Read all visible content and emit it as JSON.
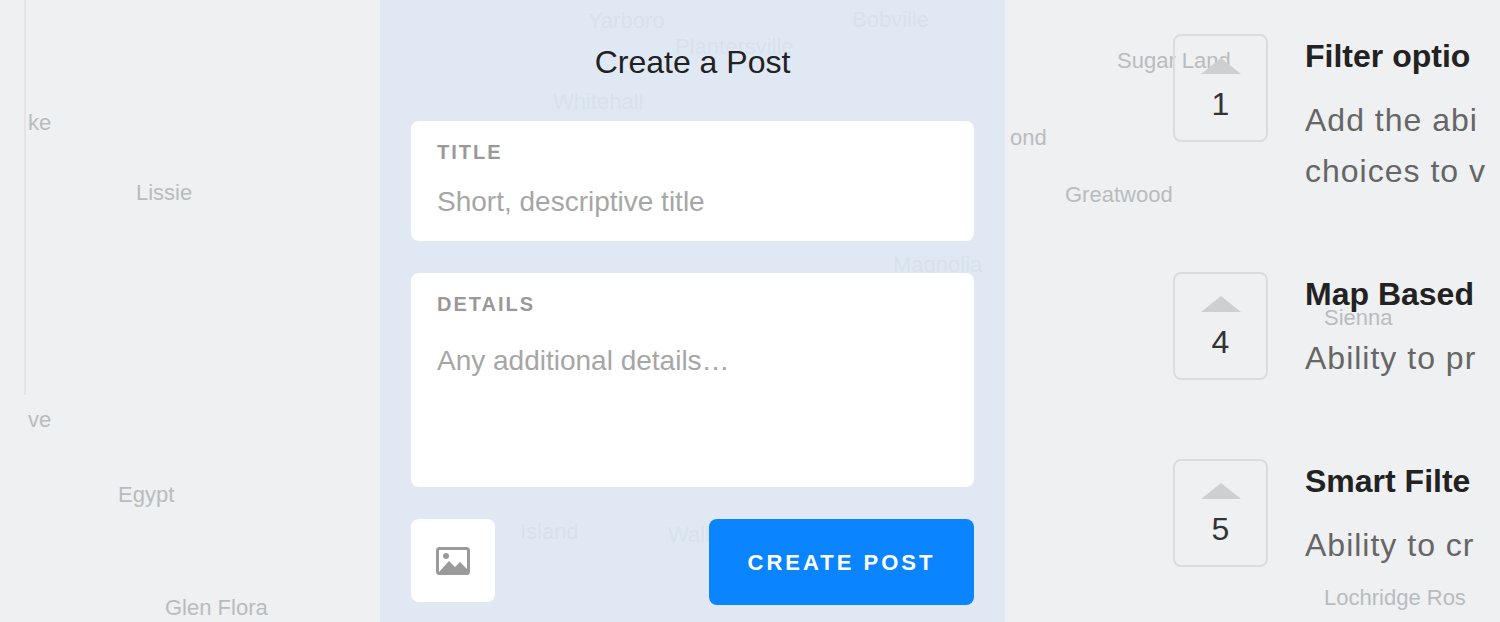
{
  "map": {
    "labels": [
      "ke",
      "Lissie",
      "ve",
      "Egypt",
      "Glen Flora",
      "Yarboro",
      "Plantersville",
      "Bobville",
      "Whitehall",
      "Magnolia",
      "Island",
      "Waller",
      "Sugar Land",
      "ond",
      "Greatwood",
      "Sienna",
      "Lochridge Ros"
    ]
  },
  "form": {
    "title": "Create a Post",
    "fields": [
      {
        "label": "TITLE",
        "placeholder": "Short, descriptive title",
        "kind": "input"
      },
      {
        "label": "DETAILS",
        "placeholder": "Any additional details…",
        "kind": "textarea"
      }
    ],
    "submit": "CREATE POST"
  },
  "ideas": [
    {
      "votes": "1",
      "title": "Filter optio",
      "lines": [
        "Add the abi",
        "choices to v"
      ]
    },
    {
      "votes": "4",
      "title": "Map Based",
      "lines": [
        "Ability to pr"
      ]
    },
    {
      "votes": "5",
      "title": "Smart Filte",
      "lines": [
        "Ability to cr"
      ]
    }
  ]
}
